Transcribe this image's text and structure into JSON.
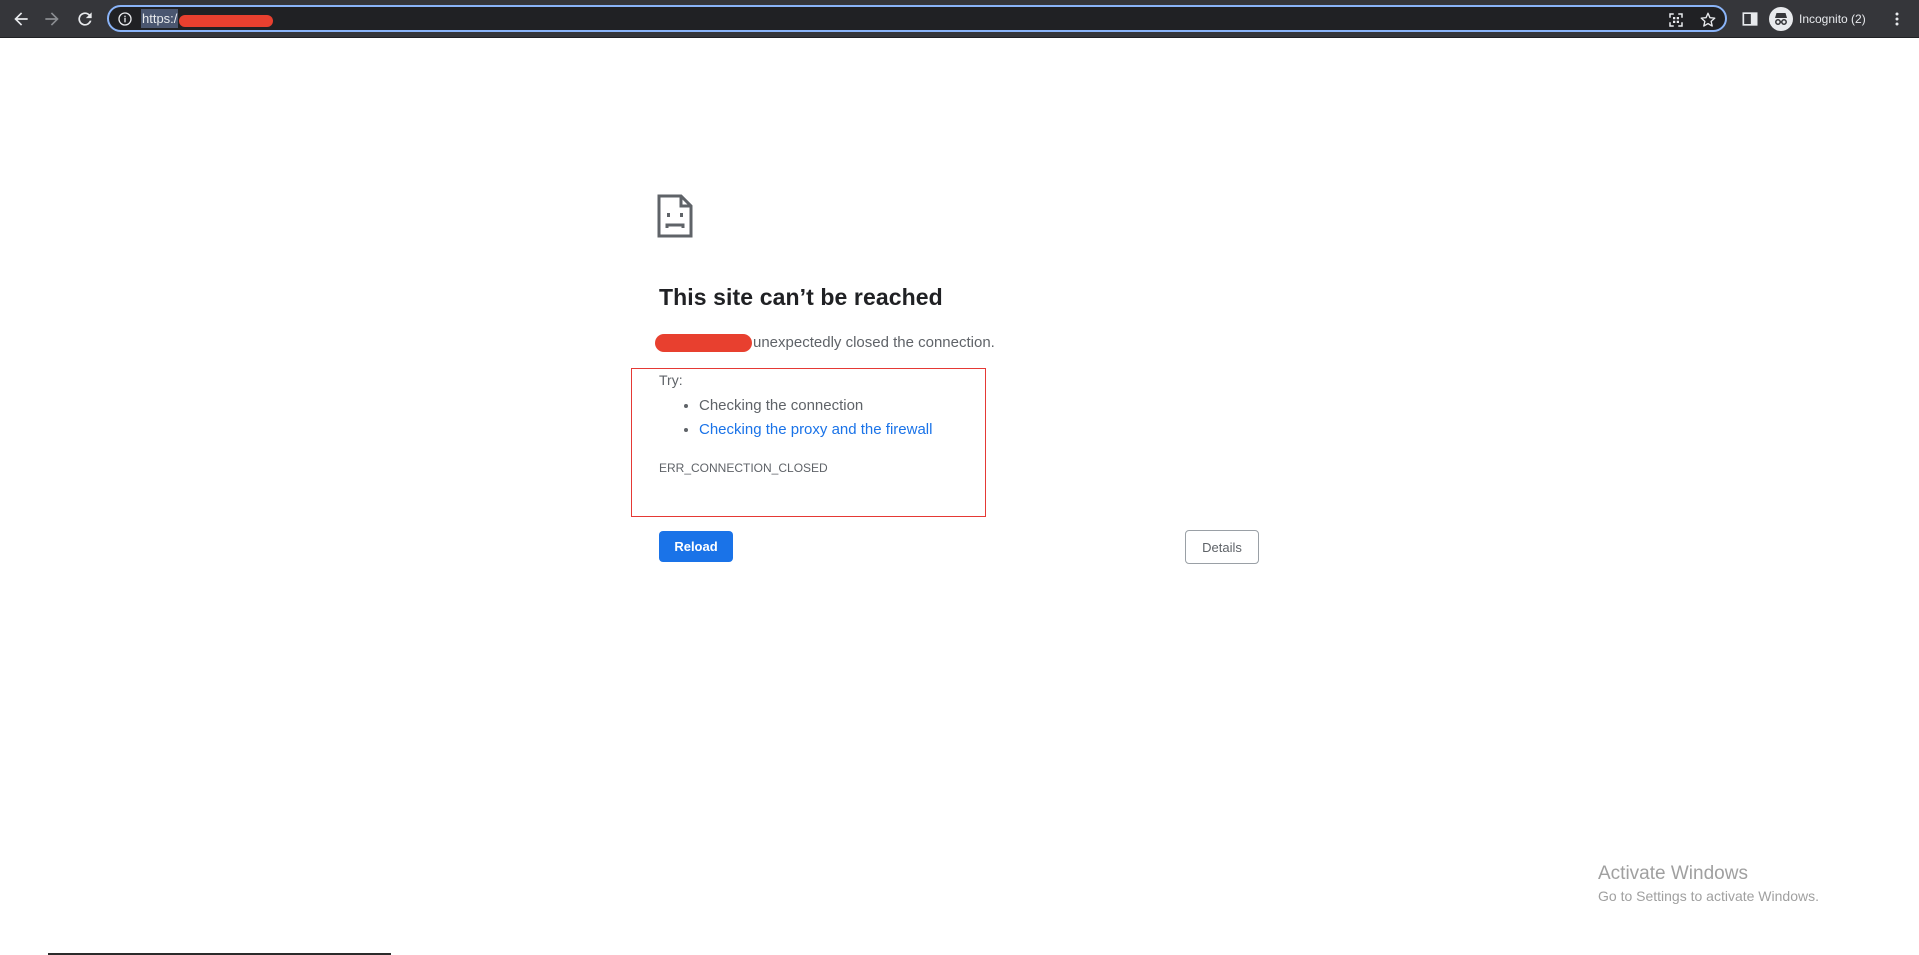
{
  "browser": {
    "url": "https:/",
    "profile_label": "Incognito (2)",
    "icons": [
      "arrow-back-icon",
      "arrow-forward-icon",
      "reload-icon",
      "info-icon",
      "qr-code-icon",
      "star-icon",
      "side-panel-icon",
      "incognito-icon",
      "more-vert-icon"
    ],
    "accent_color": "#8ab4f8"
  },
  "error_page": {
    "heading": "This site can’t be reached",
    "description": "unexpectedly closed the connection.",
    "try_label": "Try:",
    "suggestions": [
      {
        "text": "Checking the connection",
        "is_link": false
      },
      {
        "text": "Checking the proxy and the firewall",
        "is_link": true
      }
    ],
    "error_code": "ERR_CONNECTION_CLOSED",
    "reload_label": "Reload",
    "details_label": "Details",
    "link_color": "#1a73e8",
    "button_color": "#1a73e8"
  },
  "watermark": {
    "title": "Activate Windows",
    "subtitle": "Go to Settings to activate Windows."
  }
}
